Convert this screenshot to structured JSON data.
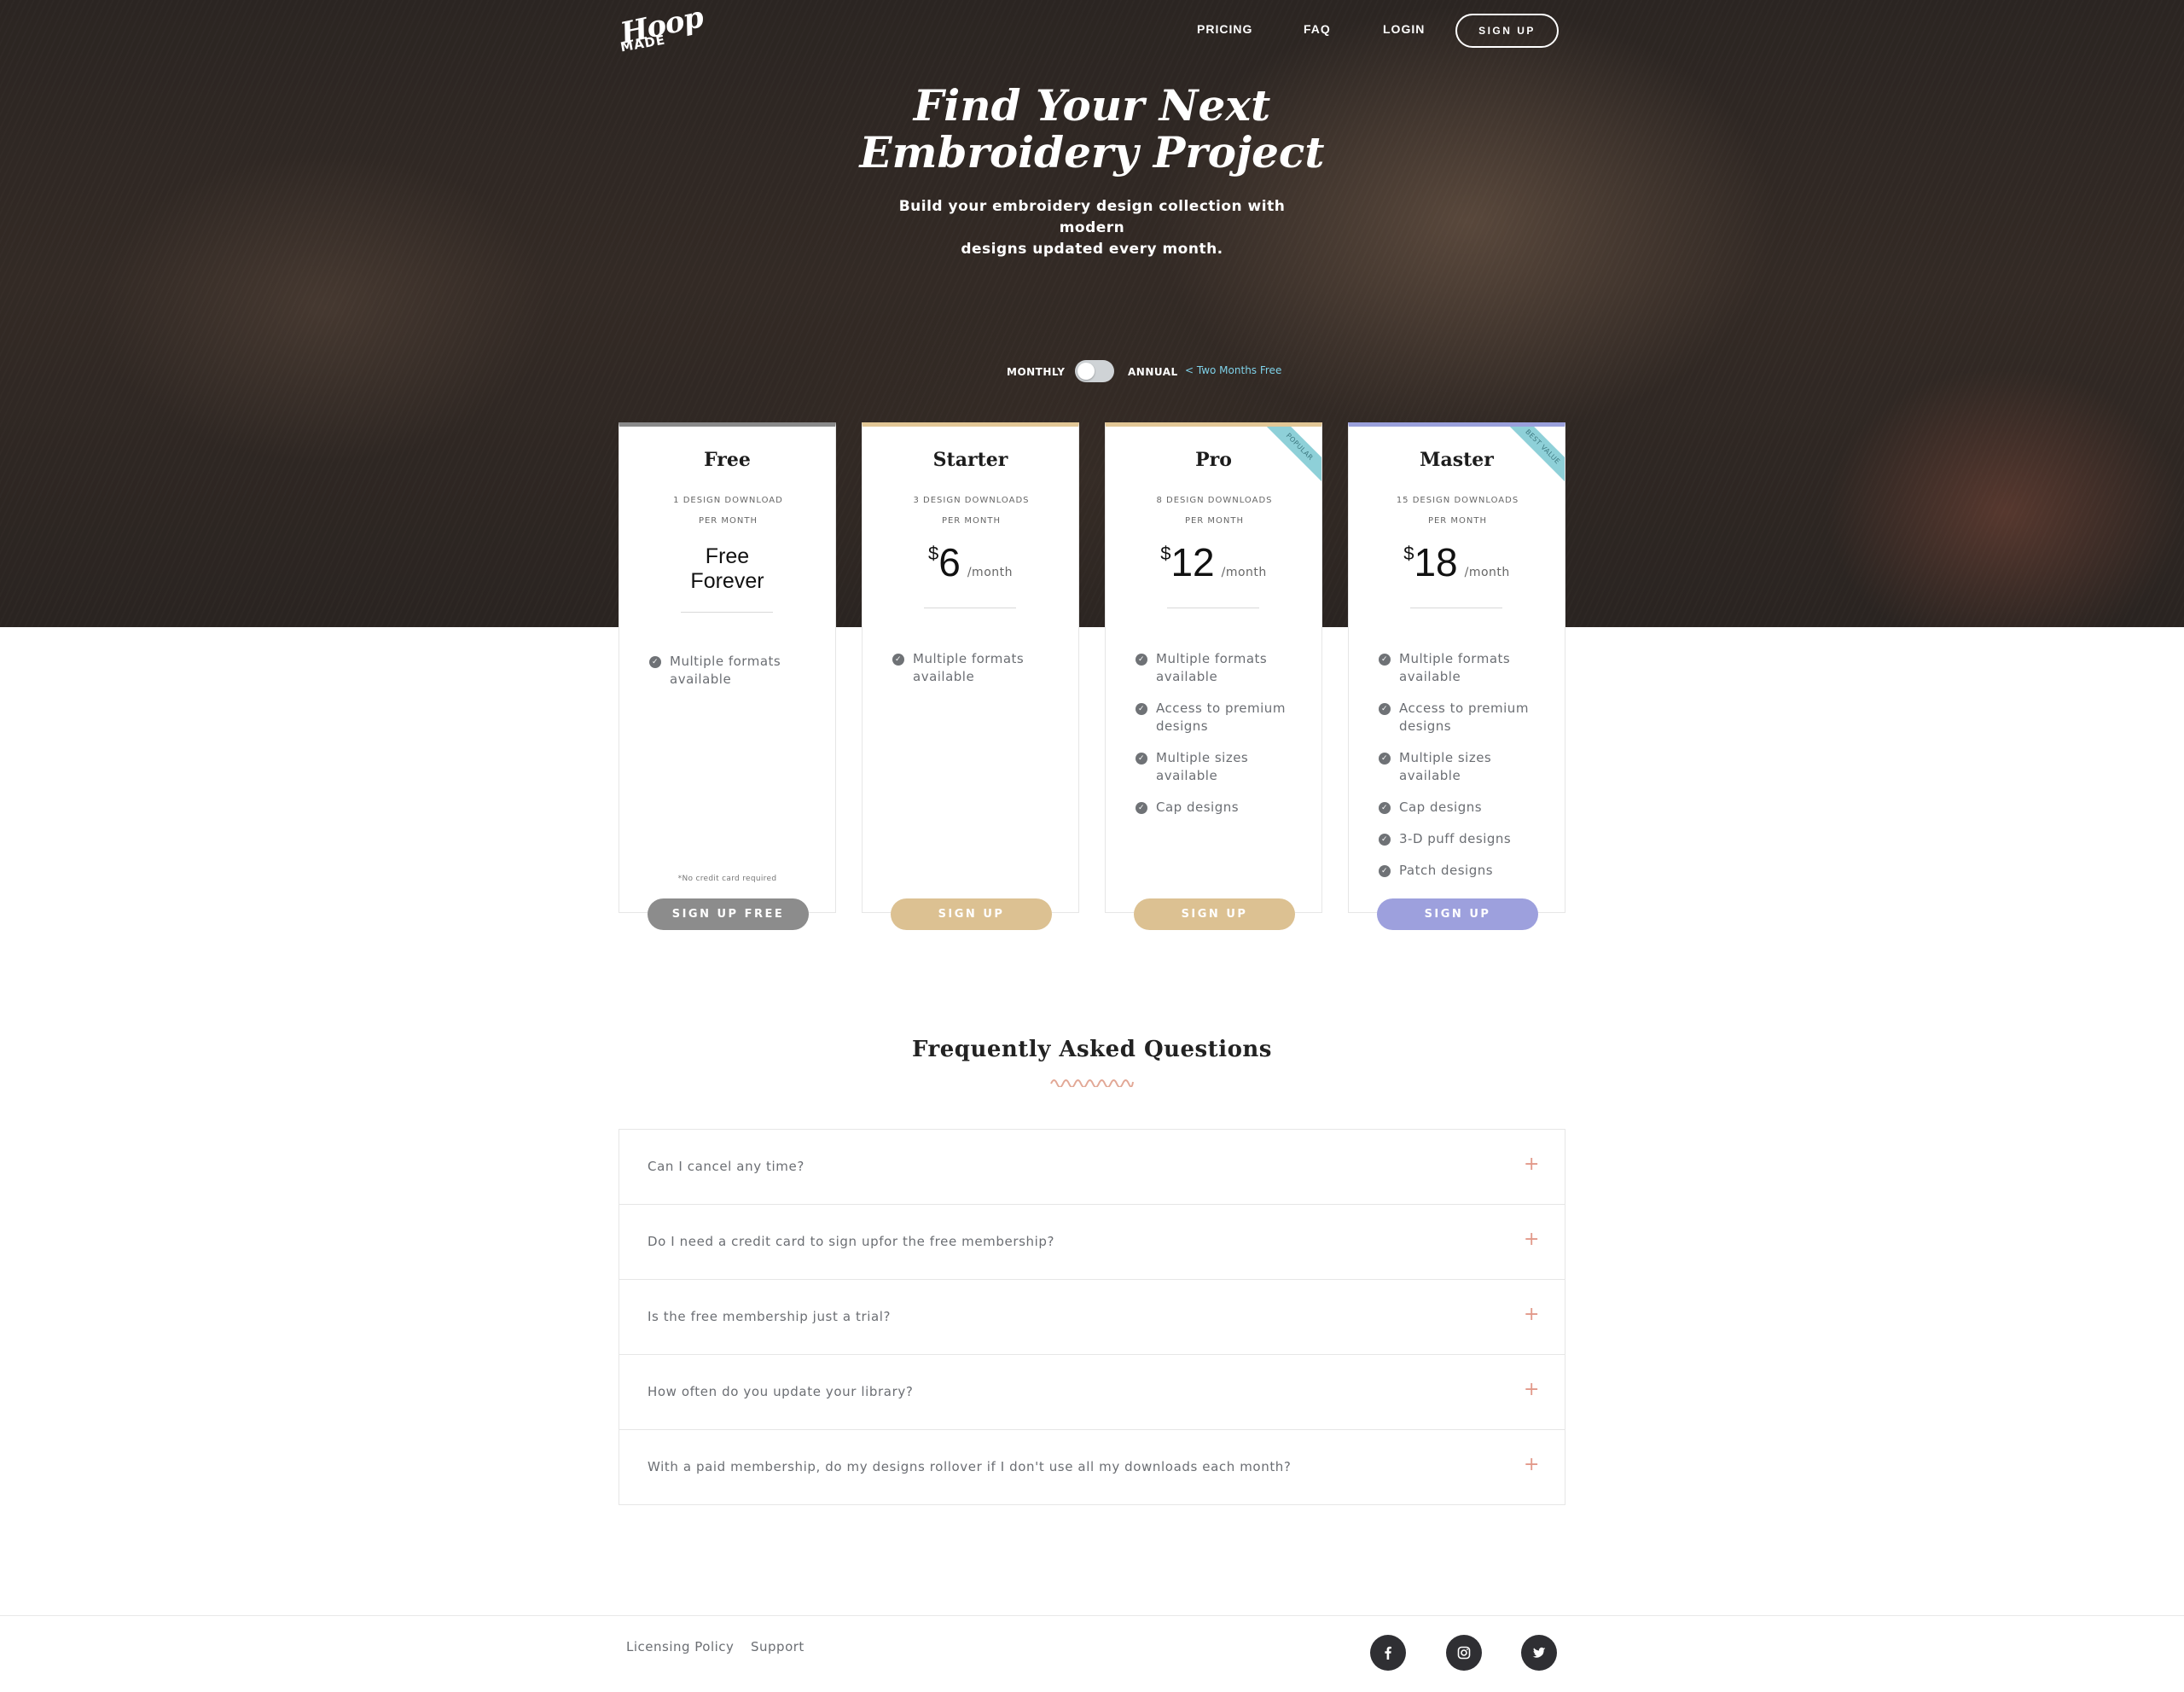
{
  "brand": {
    "logo_line1": "Hoop",
    "logo_line2": "MADE"
  },
  "nav": {
    "pricing": "PRICING",
    "faq": "FAQ",
    "login": "LOGIN",
    "signup": "SIGN UP"
  },
  "hero": {
    "title_line1": "Find Your Next",
    "title_line2": "Embroidery Project",
    "subtitle_line1": "Build your embroidery design collection with modern",
    "subtitle_line2": "designs updated every month."
  },
  "billing": {
    "monthly_label": "MONTHLY",
    "annual_label": "ANNUAL",
    "annual_note": "< Two Months Free",
    "annual_selected": false
  },
  "plans": [
    {
      "name": "Free",
      "downloads_line1": "1 DESIGN DOWNLOAD",
      "downloads_line2": "PER MONTH",
      "price_text_line1": "Free",
      "price_text_line2": "Forever",
      "features": [
        "Multiple formats available"
      ],
      "note": "*No credit card required",
      "button": "SIGN UP FREE",
      "accent": "#8a8a8a"
    },
    {
      "name": "Starter",
      "downloads_line1": "3 DESIGN DOWNLOADS",
      "downloads_line2": "PER MONTH",
      "currency": "$",
      "price": "6",
      "period": "/month",
      "features": [
        "Multiple formats available"
      ],
      "button": "SIGN UP",
      "accent": "#dcc192"
    },
    {
      "name": "Pro",
      "downloads_line1": "8 DESIGN DOWNLOADS",
      "downloads_line2": "PER MONTH",
      "currency": "$",
      "price": "12",
      "period": "/month",
      "ribbon": "POPULAR",
      "features": [
        "Multiple formats available",
        "Access to premium designs",
        "Multiple sizes available",
        "Cap designs"
      ],
      "button": "SIGN UP",
      "accent": "#dcc192"
    },
    {
      "name": "Master",
      "downloads_line1": "15 DESIGN DOWNLOADS",
      "downloads_line2": "PER MONTH",
      "currency": "$",
      "price": "18",
      "period": "/month",
      "ribbon": "BEST VALUE",
      "features": [
        "Multiple formats available",
        "Access to premium designs",
        "Multiple sizes available",
        "Cap designs",
        "3-D puff designs",
        "Patch designs"
      ],
      "button": "SIGN UP",
      "accent": "#9da0dd"
    }
  ],
  "faq": {
    "title": "Frequently Asked Questions",
    "items": [
      "Can I cancel any time?",
      "Do I need a credit card to sign upfor the free membership?",
      "Is the free membership just a trial?",
      "How often do you update your library?",
      "With a paid membership, do my designs rollover if I don't use all my downloads each month?"
    ],
    "expand_symbol": "+"
  },
  "footer": {
    "links": [
      "Licensing Policy",
      "Support"
    ],
    "social_icons": [
      "facebook-icon",
      "instagram-icon",
      "twitter-icon"
    ]
  }
}
